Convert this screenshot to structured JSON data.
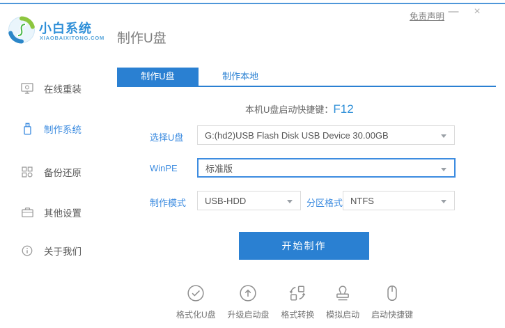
{
  "titlebar": {
    "disclaimer": "免责声明",
    "minimize": "—",
    "close": "×"
  },
  "brand": {
    "name": "小白系统",
    "domain": "XIAOBAIXITONG.COM"
  },
  "page_title": "制作U盘",
  "sidebar": {
    "items": [
      {
        "label": "在线重装",
        "icon": "monitor-reinstall-icon",
        "active": false
      },
      {
        "label": "制作系统",
        "icon": "usb-drive-icon",
        "active": true
      },
      {
        "label": "备份还原",
        "icon": "backup-grid-icon",
        "active": false
      },
      {
        "label": "其他设置",
        "icon": "toolbox-icon",
        "active": false
      },
      {
        "label": "关于我们",
        "icon": "info-circle-icon",
        "active": false
      }
    ]
  },
  "tabs": [
    {
      "label": "制作U盘",
      "active": true
    },
    {
      "label": "制作本地",
      "active": false
    }
  ],
  "content": {
    "hotkey_label": "本机U盘启动快捷键：",
    "hotkey_value": "F12",
    "form": {
      "usb_select": {
        "label": "选择U盘",
        "value": "G:(hd2)USB Flash Disk USB Device 30.00GB"
      },
      "winpe": {
        "label": "WinPE",
        "value": "标准版"
      },
      "mode": {
        "label": "制作模式",
        "value": "USB-HDD"
      },
      "partition": {
        "label": "分区格式",
        "value": "NTFS"
      }
    },
    "start_button": "开始制作"
  },
  "footer_tools": [
    {
      "label": "格式化U盘",
      "icon": "check-circle-icon"
    },
    {
      "label": "升级启动盘",
      "icon": "upload-circle-icon"
    },
    {
      "label": "格式转换",
      "icon": "format-convert-icon"
    },
    {
      "label": "模拟启动",
      "icon": "stamp-icon"
    },
    {
      "label": "启动快捷键",
      "icon": "mouse-icon"
    }
  ],
  "colors": {
    "primary_blue": "#2a80d2",
    "label_blue": "#3d8ce0",
    "top_line_blue": "#4f97d9",
    "text_gray": "#666666",
    "icon_gray": "#8f8f8f"
  }
}
